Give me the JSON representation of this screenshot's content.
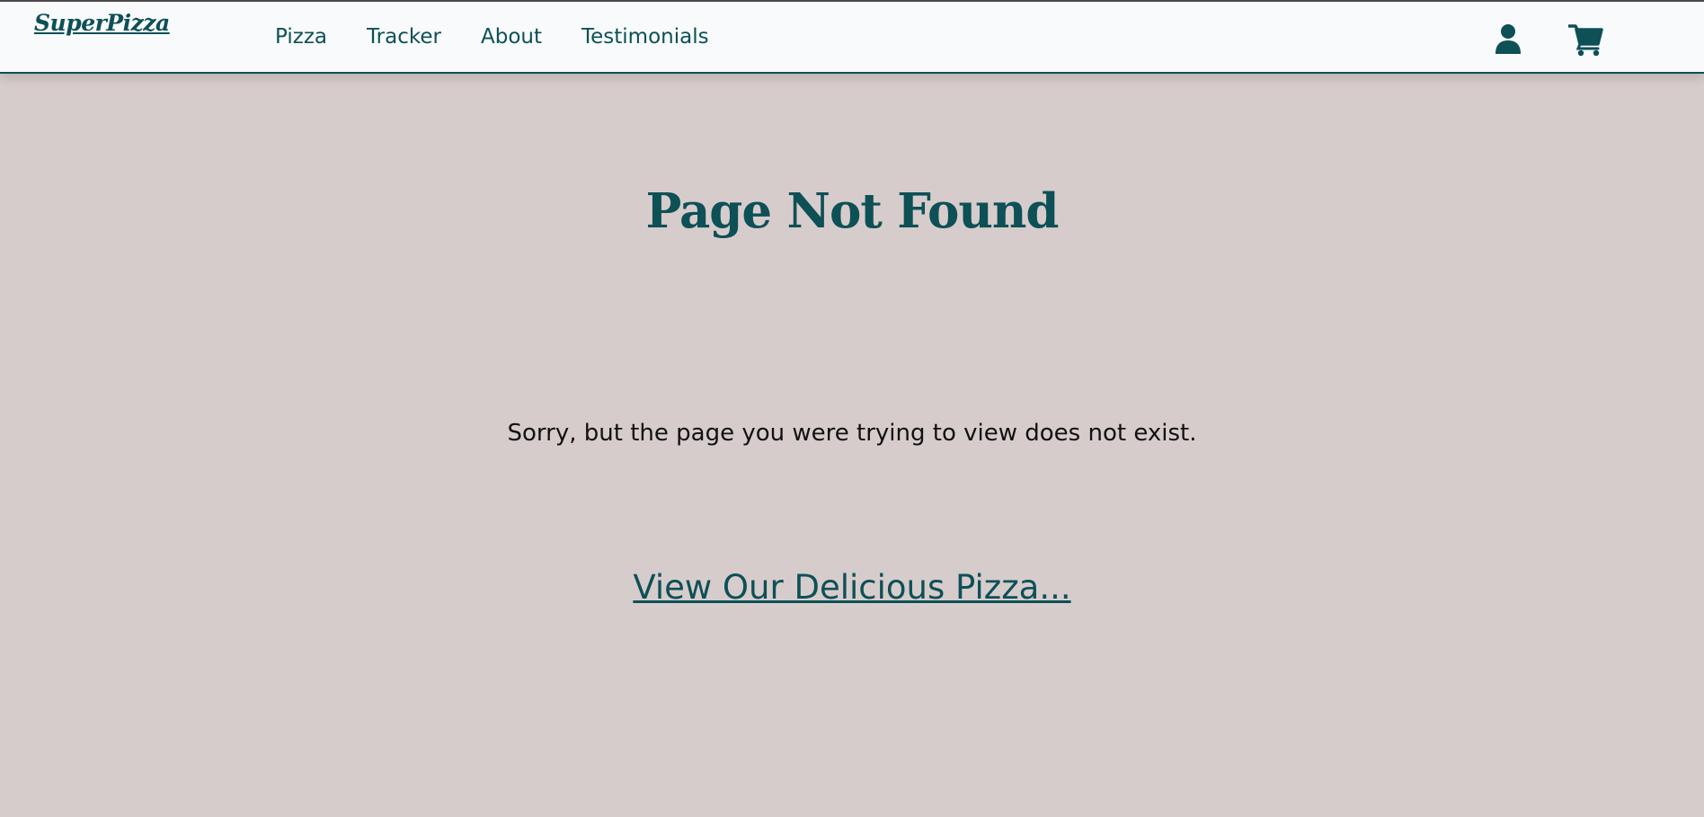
{
  "header": {
    "logo_text": "SuperPizza",
    "nav": [
      {
        "label": "Pizza"
      },
      {
        "label": "Tracker"
      },
      {
        "label": "About"
      },
      {
        "label": "Testimonials"
      }
    ],
    "icons": {
      "account": "user-icon",
      "cart": "shopping-cart-icon"
    }
  },
  "main": {
    "title": "Page Not Found",
    "message": "Sorry, but the page you were trying to view does not exist.",
    "cta_label": "View Our Delicious Pizza..."
  },
  "colors": {
    "brand": "#0d5056",
    "background": "#d7cccc",
    "header_bg": "#f8fafc"
  }
}
